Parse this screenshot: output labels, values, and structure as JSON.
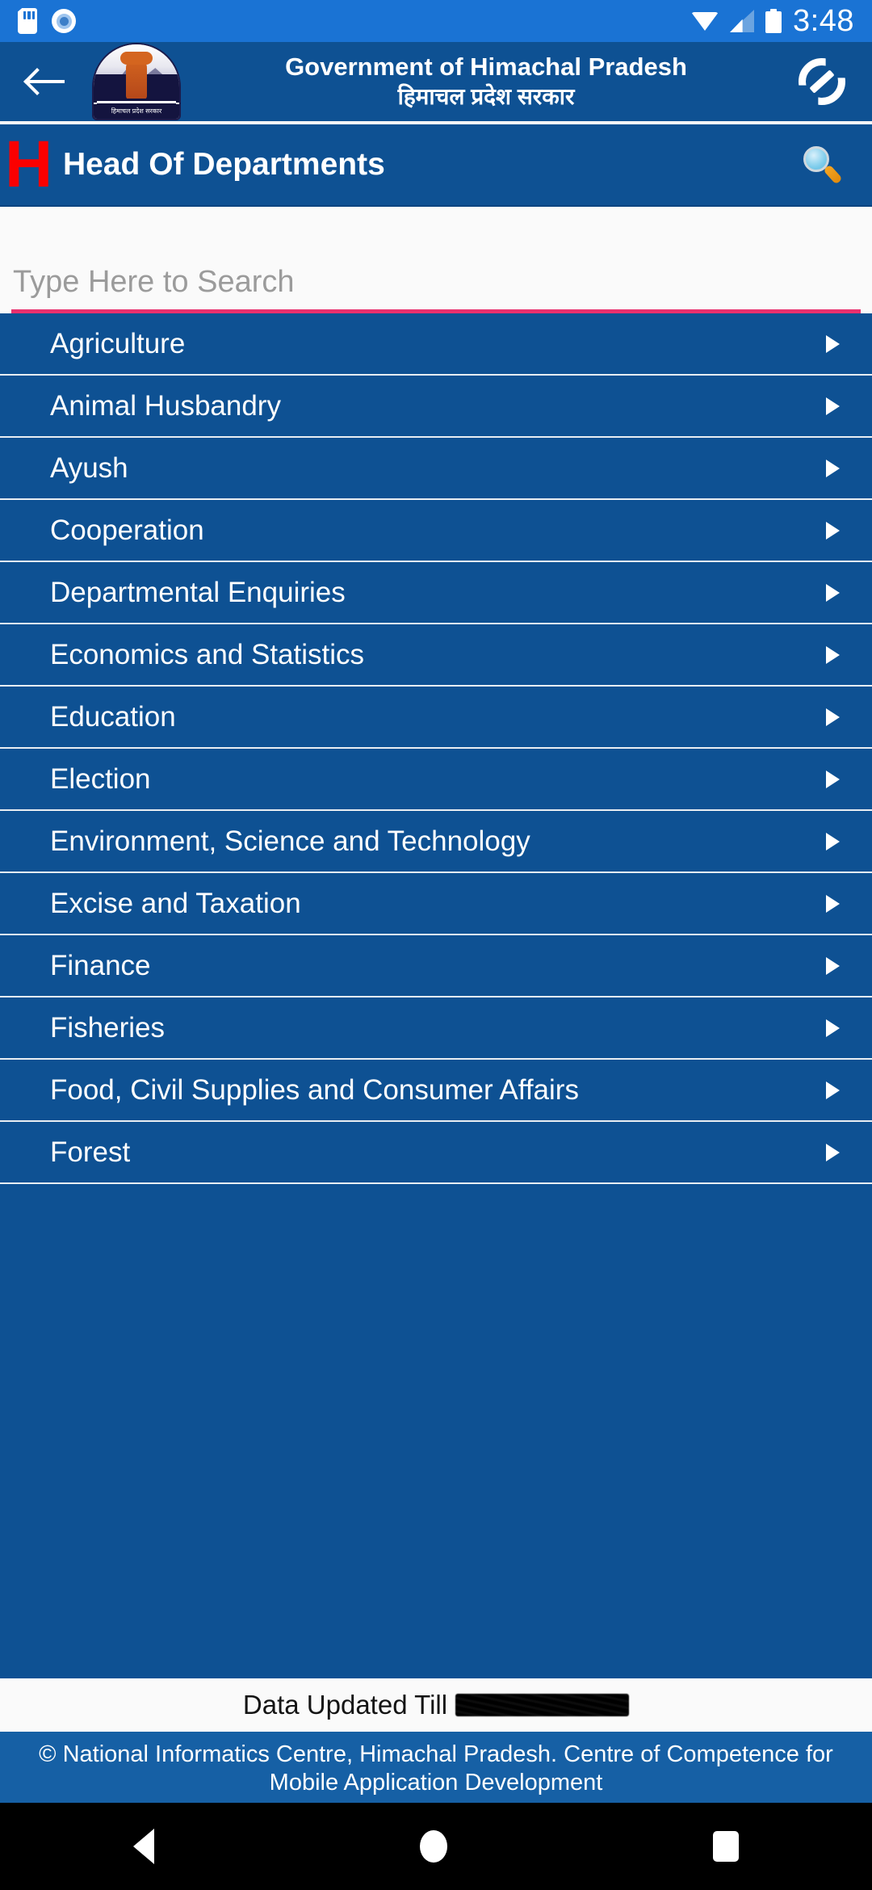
{
  "status_bar": {
    "time": "3:48",
    "icons": [
      "sd-card-icon",
      "screen-record-icon",
      "wifi-icon",
      "cellular-signal-icon",
      "battery-icon"
    ]
  },
  "gov_header": {
    "back_icon": "back-arrow-icon",
    "emblem_caption": "हिमाचल प्रदेश सरकार",
    "title_en": "Government of Himachal Pradesh",
    "title_hi": "हिमाचल प्रदेश सरकार",
    "sync_icon": "sync-icon"
  },
  "app_bar": {
    "logo_letter": "H",
    "title": "Head Of Departments",
    "search_icon": "magnifier-icon"
  },
  "search": {
    "value": "",
    "placeholder": "Type Here to Search",
    "underline_color": "#e8306e"
  },
  "departments": [
    {
      "label": "Agriculture"
    },
    {
      "label": "Animal Husbandry"
    },
    {
      "label": "Ayush"
    },
    {
      "label": "Cooperation"
    },
    {
      "label": "Departmental Enquiries"
    },
    {
      "label": "Economics and Statistics"
    },
    {
      "label": "Education"
    },
    {
      "label": "Election"
    },
    {
      "label": "Environment, Science and Technology"
    },
    {
      "label": "Excise and Taxation"
    },
    {
      "label": "Finance"
    },
    {
      "label": "Fisheries"
    },
    {
      "label": "Food, Civil Supplies and Consumer Affairs"
    },
    {
      "label": "Forest"
    }
  ],
  "footer": {
    "updated_label": "Data Updated Till",
    "updated_value_redacted": true,
    "copyright": "© National Informatics Centre, Himachal Pradesh. Centre of Competence for Mobile Application Development"
  },
  "nav_bar": {
    "back": "nav-back-icon",
    "home": "nav-home-icon",
    "recents": "nav-recents-icon"
  },
  "colors": {
    "status_bar_blue": "#1a73d4",
    "header_blue": "#0e5193",
    "list_blue": "#0e5193",
    "footer_blue": "#1660a5",
    "logo_red": "#fb0000",
    "accent_pink": "#e8306e",
    "panel_white": "#fafafa"
  }
}
